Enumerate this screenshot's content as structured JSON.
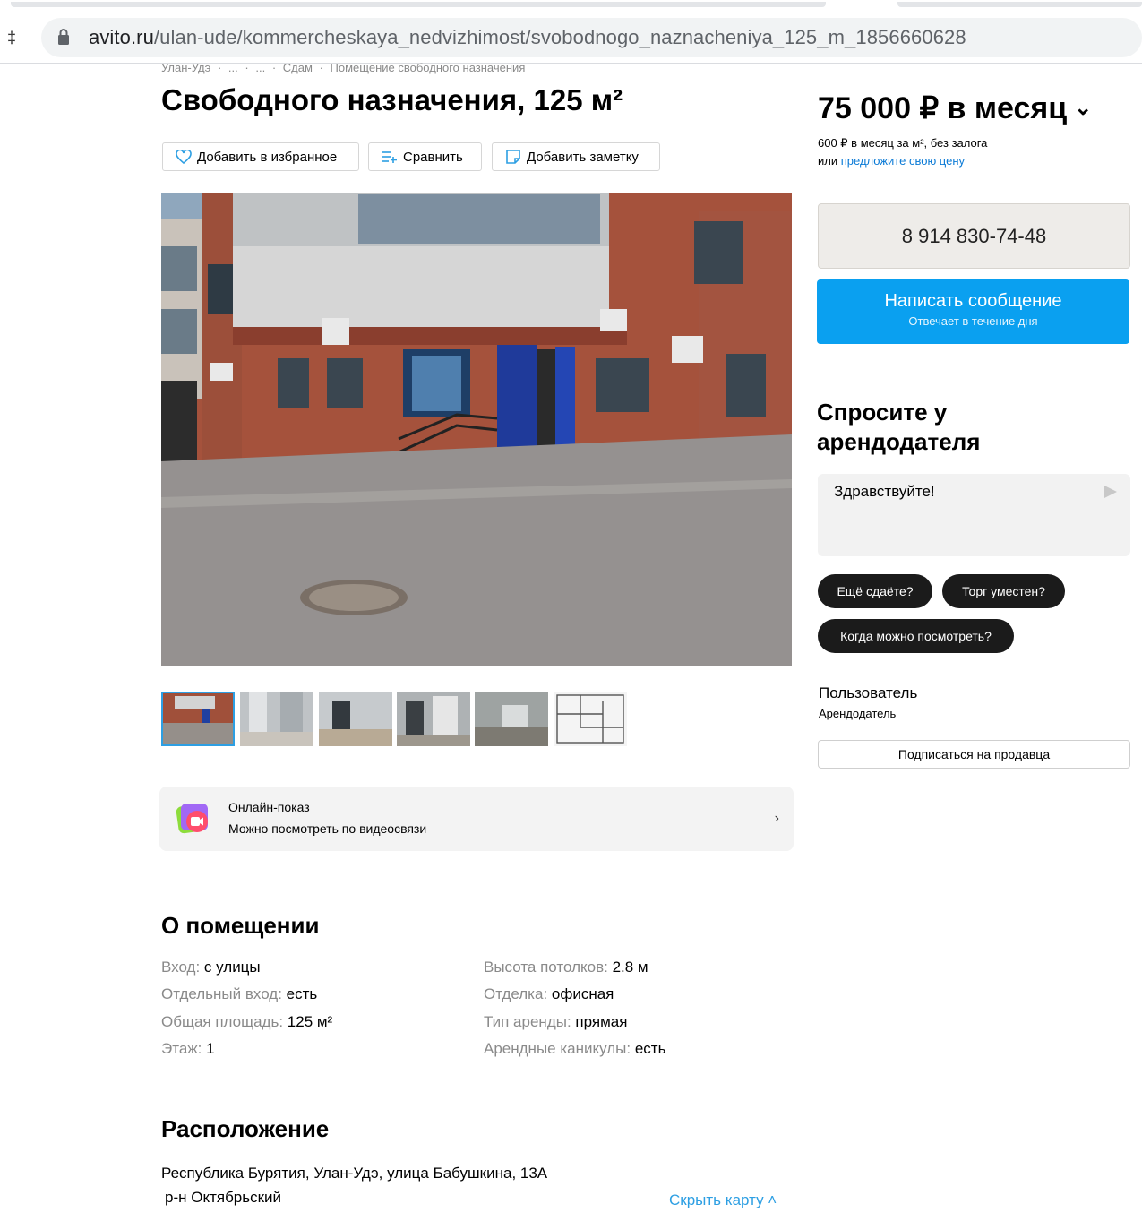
{
  "browser": {
    "url_host": "avito.ru",
    "url_path": "/ulan-ude/kommercheskaya_nedvizhimost/svobodnogo_naznacheniya_125_m_1856660628",
    "left_mark": "‡"
  },
  "breadcrumbs": [
    "Улан-Удэ",
    "·",
    "...",
    "·",
    "...",
    "·",
    "Сдам",
    "·",
    "Помещение свободного назначения"
  ],
  "listing": {
    "title": "Свободного назначения, 125 м²",
    "actions": {
      "favorite": "Добавить в избранное",
      "compare": "Сравнить",
      "note": "Добавить заметку"
    },
    "photo_icon": "storefront-photo",
    "thumbnails": [
      "facade-photo",
      "corridor-photo",
      "hall-photo",
      "room-photo",
      "interior-photo",
      "floor-plan"
    ],
    "online_show": {
      "title": "Онлайн-показ",
      "subtitle": "Можно посмотреть по видеосвязи",
      "chevron": "›"
    }
  },
  "about": {
    "heading": "О помещении",
    "left": [
      {
        "key": "Вход:",
        "value": "с улицы"
      },
      {
        "key": "Отдельный вход:",
        "value": "есть"
      },
      {
        "key": "Общая площадь:",
        "value": "125 м²"
      },
      {
        "key": "Этаж:",
        "value": "1"
      }
    ],
    "right": [
      {
        "key": "Высота потолков:",
        "value": "2.8 м"
      },
      {
        "key": "Отделка:",
        "value": "офисная"
      },
      {
        "key": "Тип аренды:",
        "value": "прямая"
      },
      {
        "key": "Арендные каникулы:",
        "value": "есть"
      }
    ]
  },
  "location": {
    "heading": "Расположение",
    "address": "Республика Бурятия, Улан-Удэ, улица Бабушкина, 13А",
    "district": "р-н Октябрьский",
    "hide_map": "Скрыть карту ˄"
  },
  "sidebar": {
    "price": "75 000 ₽ в месяц",
    "price_chevron": "⌄",
    "price_sub": "600 ₽ в месяц за м², без залога",
    "price_or": "или",
    "price_offer": "предложите свою цену",
    "phone": "8 914 830-74-48",
    "message_btn": "Написать сообщение",
    "message_sub": "Отвечает в течение дня",
    "ask_heading": "Спросите у арендодателя",
    "ask_placeholder": "Здравствуйте!",
    "chips": [
      "Ещё сдаёте?",
      "Торг уместен?",
      "Когда можно посмотреть?"
    ],
    "user_name": "Пользователь",
    "user_role": "Арендодатель",
    "subscribe": "Подписаться на продавца"
  },
  "colors": {
    "accent_blue": "#0aa0f0",
    "link_blue": "#2d9fe3",
    "chip_dark": "#1b1b1b"
  }
}
